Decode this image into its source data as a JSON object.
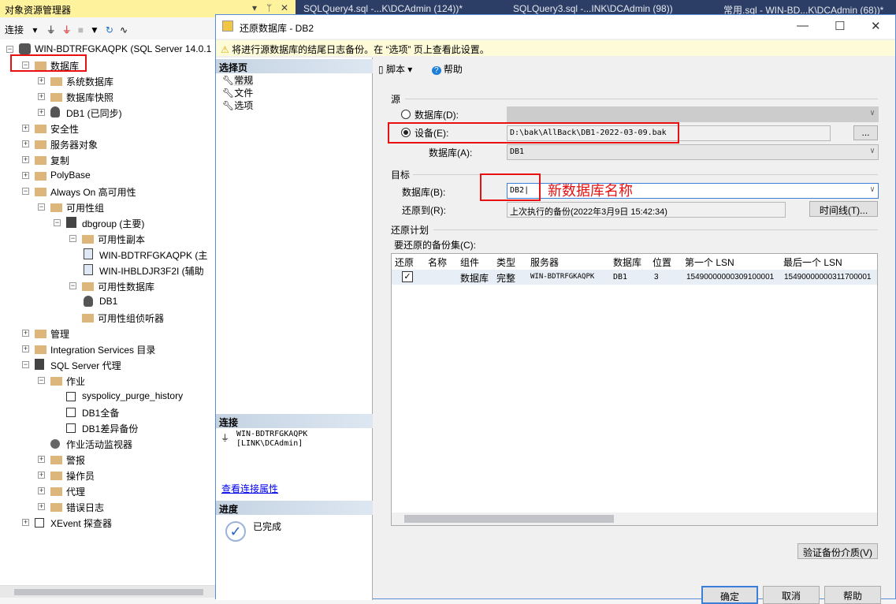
{
  "object_explorer": {
    "title": "对象资源管理器",
    "connect_label": "连接",
    "tree": [
      {
        "level": 0,
        "label": "WIN-BDTRFGKAQPK (SQL Server 14.0.1",
        "exp": "-",
        "icon": "server"
      },
      {
        "level": 1,
        "label": "数据库",
        "exp": "-",
        "icon": "folder"
      },
      {
        "level": 2,
        "label": "系统数据库",
        "exp": "+",
        "icon": "folder"
      },
      {
        "level": 2,
        "label": "数据库快照",
        "exp": "+",
        "icon": "folder"
      },
      {
        "level": 2,
        "label": "DB1 (已同步)",
        "exp": "+",
        "icon": "database"
      },
      {
        "level": 1,
        "label": "安全性",
        "exp": "+",
        "icon": "folder"
      },
      {
        "level": 1,
        "label": "服务器对象",
        "exp": "+",
        "icon": "folder"
      },
      {
        "level": 1,
        "label": "复制",
        "exp": "+",
        "icon": "folder"
      },
      {
        "level": 1,
        "label": "PolyBase",
        "exp": "+",
        "icon": "folder"
      },
      {
        "level": 1,
        "label": "Always On 高可用性",
        "exp": "-",
        "icon": "folder"
      },
      {
        "level": 2,
        "label": "可用性组",
        "exp": "-",
        "icon": "folder"
      },
      {
        "level": 3,
        "label": "dbgroup (主要)",
        "exp": "-",
        "icon": "ag"
      },
      {
        "level": 4,
        "label": "可用性副本",
        "exp": "-",
        "icon": "folder"
      },
      {
        "level": 5,
        "label": "WIN-BDTRFGKAQPK (主",
        "exp": "",
        "icon": "replica"
      },
      {
        "level": 5,
        "label": "WIN-IHBLDJR3F2I (辅助",
        "exp": "",
        "icon": "replica"
      },
      {
        "level": 4,
        "label": "可用性数据库",
        "exp": "-",
        "icon": "folder"
      },
      {
        "level": 5,
        "label": "DB1",
        "exp": "",
        "icon": "database"
      },
      {
        "level": 4,
        "label": "可用性组侦听器",
        "exp": "",
        "icon": "folder"
      },
      {
        "level": 1,
        "label": "管理",
        "exp": "+",
        "icon": "folder"
      },
      {
        "level": 1,
        "label": "Integration Services 目录",
        "exp": "+",
        "icon": "folder"
      },
      {
        "level": 1,
        "label": "SQL Server 代理",
        "exp": "-",
        "icon": "agent"
      },
      {
        "level": 2,
        "label": "作业",
        "exp": "-",
        "icon": "folder"
      },
      {
        "level": 3,
        "label": "syspolicy_purge_history",
        "exp": "",
        "icon": "job"
      },
      {
        "level": 3,
        "label": "DB1全备",
        "exp": "",
        "icon": "job"
      },
      {
        "level": 3,
        "label": "DB1差异备份",
        "exp": "",
        "icon": "job"
      },
      {
        "level": 2,
        "label": "作业活动监视器",
        "exp": "",
        "icon": "monitor"
      },
      {
        "level": 2,
        "label": "警报",
        "exp": "+",
        "icon": "folder"
      },
      {
        "level": 2,
        "label": "操作员",
        "exp": "+",
        "icon": "folder"
      },
      {
        "level": 2,
        "label": "代理",
        "exp": "+",
        "icon": "folder"
      },
      {
        "level": 2,
        "label": "错误日志",
        "exp": "+",
        "icon": "folder"
      },
      {
        "level": 1,
        "label": "XEvent 探查器",
        "exp": "+",
        "icon": "xevent"
      }
    ]
  },
  "tabs": [
    "SQLQuery4.sql -...K\\DCAdmin (124))*",
    "SQLQuery3.sql -...INK\\DCAdmin (98))",
    "常用.sql - WIN-BD...K\\DCAdmin (68))*"
  ],
  "dialog": {
    "title": "还原数据库 - DB2",
    "warning": "将进行源数据库的结尾日志备份。在 “选项” 页上查看此设置。",
    "select_page": "选择页",
    "pages": [
      "常规",
      "文件",
      "选项"
    ],
    "script_label": "脚本",
    "help_label": "帮助",
    "source": {
      "heading": "源",
      "database_label": "数据库(D):",
      "device_label": "设备(E):",
      "device_value": "D:\\bak\\AllBack\\DB1-2022-03-09.bak",
      "browse": "...",
      "db_label": "数据库(A):",
      "db_value": "DB1"
    },
    "target": {
      "heading": "目标",
      "database_label": "数据库(B):",
      "database_value": "DB2",
      "annotation": "新数据库名称",
      "restore_to_label": "还原到(R):",
      "restore_to_value": "上次执行的备份(2022年3月9日 15:42:34)",
      "timeline": "时间线(T)..."
    },
    "plan": {
      "heading": "还原计划",
      "sets_label": "要还原的备份集(C):",
      "columns": [
        "还原",
        "名称",
        "组件",
        "类型",
        "服务器",
        "数据库",
        "位置",
        "第一个 LSN",
        "最后一个 LSN"
      ],
      "rows": [
        {
          "restore": true,
          "name": "",
          "component": "数据库",
          "type": "完整",
          "server": "WIN-BDTRFGKAQPK",
          "database": "DB1",
          "position": "3",
          "first_lsn": "15490000000309100001",
          "last_lsn": "15490000000311700001"
        }
      ]
    },
    "verify": "验证备份介质(V)",
    "connection": {
      "heading": "连接",
      "server": "WIN-BDTRFGKAQPK",
      "user": "[LINK\\DCAdmin]",
      "link": "查看连接属性"
    },
    "progress": {
      "heading": "进度",
      "status": "已完成"
    },
    "buttons": {
      "ok": "确定",
      "cancel": "取消",
      "help": "帮助"
    }
  }
}
